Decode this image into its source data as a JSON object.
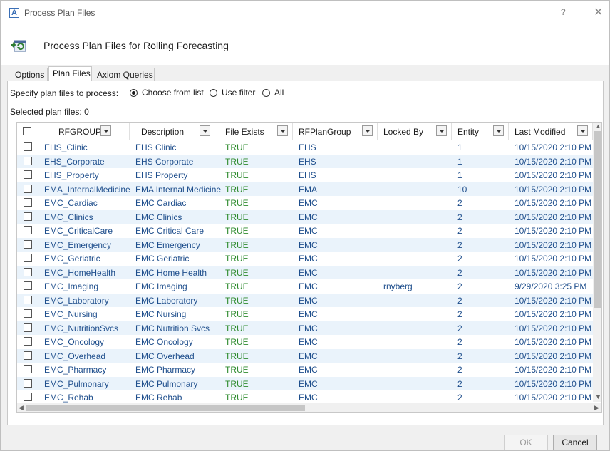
{
  "window": {
    "title": "Process Plan Files",
    "app_icon_letter": "A",
    "help_glyph": "?",
    "close_glyph": "✕"
  },
  "header": {
    "title": "Process Plan Files for Rolling Forecasting",
    "icon": "process-refresh-icon"
  },
  "tabs": [
    {
      "label": "Options",
      "active": false
    },
    {
      "label": "Plan Files",
      "active": true
    },
    {
      "label": "Axiom Queries",
      "active": false
    }
  ],
  "spec": {
    "label": "Specify plan files to process:",
    "options": [
      {
        "label": "Choose from list",
        "checked": true
      },
      {
        "label": "Use filter",
        "checked": false
      },
      {
        "label": "All",
        "checked": false
      }
    ]
  },
  "selected_label": "Selected plan files: 0",
  "columns": [
    "RFGROUP",
    "Description",
    "File Exists",
    "RFPlanGroup",
    "Locked By",
    "Entity",
    "Last Modified"
  ],
  "rows": [
    {
      "rfgroup": "EHS_Clinic",
      "desc": "EHS Clinic",
      "exists": "TRUE",
      "group": "EHS",
      "locked": "",
      "entity": "1",
      "modified": "10/15/2020 2:10 PM"
    },
    {
      "rfgroup": "EHS_Corporate",
      "desc": "EHS Corporate",
      "exists": "TRUE",
      "group": "EHS",
      "locked": "",
      "entity": "1",
      "modified": "10/15/2020 2:10 PM"
    },
    {
      "rfgroup": "EHS_Property",
      "desc": "EHS Property",
      "exists": "TRUE",
      "group": "EHS",
      "locked": "",
      "entity": "1",
      "modified": "10/15/2020 2:10 PM"
    },
    {
      "rfgroup": "EMA_InternalMedicine",
      "desc": "EMA Internal Medicine",
      "exists": "TRUE",
      "group": "EMA",
      "locked": "",
      "entity": "10",
      "modified": "10/15/2020 2:10 PM"
    },
    {
      "rfgroup": "EMC_Cardiac",
      "desc": "EMC Cardiac",
      "exists": "TRUE",
      "group": "EMC",
      "locked": "",
      "entity": "2",
      "modified": "10/15/2020 2:10 PM"
    },
    {
      "rfgroup": "EMC_Clinics",
      "desc": "EMC Clinics",
      "exists": "TRUE",
      "group": "EMC",
      "locked": "",
      "entity": "2",
      "modified": "10/15/2020 2:10 PM"
    },
    {
      "rfgroup": "EMC_CriticalCare",
      "desc": "EMC Critical Care",
      "exists": "TRUE",
      "group": "EMC",
      "locked": "",
      "entity": "2",
      "modified": "10/15/2020 2:10 PM"
    },
    {
      "rfgroup": "EMC_Emergency",
      "desc": "EMC Emergency",
      "exists": "TRUE",
      "group": "EMC",
      "locked": "",
      "entity": "2",
      "modified": "10/15/2020 2:10 PM"
    },
    {
      "rfgroup": "EMC_Geriatric",
      "desc": "EMC Geriatric",
      "exists": "TRUE",
      "group": "EMC",
      "locked": "",
      "entity": "2",
      "modified": "10/15/2020 2:10 PM"
    },
    {
      "rfgroup": "EMC_HomeHealth",
      "desc": "EMC Home Health",
      "exists": "TRUE",
      "group": "EMC",
      "locked": "",
      "entity": "2",
      "modified": "10/15/2020 2:10 PM"
    },
    {
      "rfgroup": "EMC_Imaging",
      "desc": "EMC Imaging",
      "exists": "TRUE",
      "group": "EMC",
      "locked": "rnyberg",
      "entity": "2",
      "modified": "9/29/2020 3:25 PM"
    },
    {
      "rfgroup": "EMC_Laboratory",
      "desc": "EMC Laboratory",
      "exists": "TRUE",
      "group": "EMC",
      "locked": "",
      "entity": "2",
      "modified": "10/15/2020 2:10 PM"
    },
    {
      "rfgroup": "EMC_Nursing",
      "desc": "EMC Nursing",
      "exists": "TRUE",
      "group": "EMC",
      "locked": "",
      "entity": "2",
      "modified": "10/15/2020 2:10 PM"
    },
    {
      "rfgroup": "EMC_NutritionSvcs",
      "desc": "EMC Nutrition Svcs",
      "exists": "TRUE",
      "group": "EMC",
      "locked": "",
      "entity": "2",
      "modified": "10/15/2020 2:10 PM"
    },
    {
      "rfgroup": "EMC_Oncology",
      "desc": "EMC Oncology",
      "exists": "TRUE",
      "group": "EMC",
      "locked": "",
      "entity": "2",
      "modified": "10/15/2020 2:10 PM"
    },
    {
      "rfgroup": "EMC_Overhead",
      "desc": "EMC Overhead",
      "exists": "TRUE",
      "group": "EMC",
      "locked": "",
      "entity": "2",
      "modified": "10/15/2020 2:10 PM"
    },
    {
      "rfgroup": "EMC_Pharmacy",
      "desc": "EMC Pharmacy",
      "exists": "TRUE",
      "group": "EMC",
      "locked": "",
      "entity": "2",
      "modified": "10/15/2020 2:10 PM"
    },
    {
      "rfgroup": "EMC_Pulmonary",
      "desc": "EMC Pulmonary",
      "exists": "TRUE",
      "group": "EMC",
      "locked": "",
      "entity": "2",
      "modified": "10/15/2020 2:10 PM"
    },
    {
      "rfgroup": "EMC_Rehab",
      "desc": "EMC Rehab",
      "exists": "TRUE",
      "group": "EMC",
      "locked": "",
      "entity": "2",
      "modified": "10/15/2020 2:10 PM"
    }
  ],
  "buttons": {
    "ok": "OK",
    "cancel": "Cancel"
  },
  "colors": {
    "link_text": "#1e4e8c",
    "true_text": "#2e8b2e",
    "alt_row": "#eaf3fb"
  }
}
